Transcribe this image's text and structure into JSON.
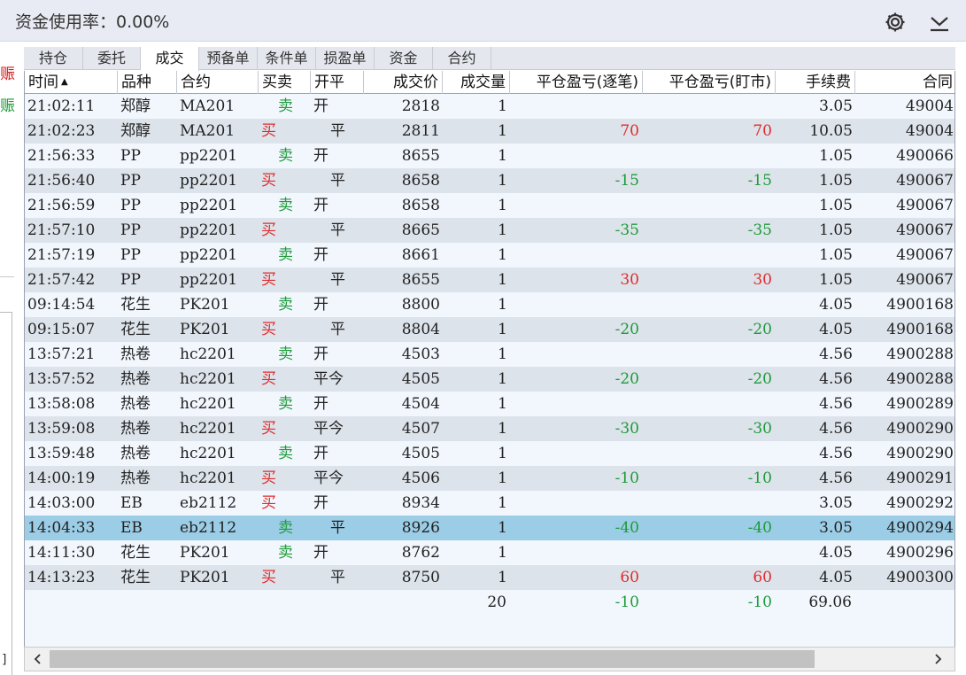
{
  "header": {
    "title": "资金使用率：0.00%",
    "settings_icon": "gear-icon",
    "collapse_icon": "chevron-down-icon"
  },
  "left_strip": {
    "char1": "赈",
    "char2": "赈",
    "char3": "]"
  },
  "colors": {
    "red": "#e02c2c",
    "green": "#1d9b3a",
    "selected_row": "#9ccde6",
    "alt_row": "#dde3eb",
    "row": "#f2f7fd"
  },
  "tabs": [
    {
      "label": "持仓",
      "active": false
    },
    {
      "label": "委托",
      "active": false
    },
    {
      "label": "成交",
      "active": true
    },
    {
      "label": "预备单",
      "active": false
    },
    {
      "label": "条件单",
      "active": false
    },
    {
      "label": "损盈单",
      "active": false
    },
    {
      "label": "资金",
      "active": false
    },
    {
      "label": "合约",
      "active": false
    }
  ],
  "columns": [
    {
      "label": "时间",
      "sort": "asc"
    },
    {
      "label": "品种"
    },
    {
      "label": "合约"
    },
    {
      "label": "买卖"
    },
    {
      "label": "开平"
    },
    {
      "label": "成交价"
    },
    {
      "label": "成交量"
    },
    {
      "label": "平仓盈亏(逐笔)"
    },
    {
      "label": "平仓盈亏(盯市)"
    },
    {
      "label": "手续费"
    },
    {
      "label": "合同"
    }
  ],
  "sort_indicator": "▲",
  "rows": [
    [
      "21:02:11",
      "郑醇",
      "MA201",
      "卖",
      "开",
      "2818",
      "1",
      "",
      "",
      "3.05",
      "49004"
    ],
    [
      "21:02:23",
      "郑醇",
      "MA201",
      "买",
      "平",
      "2811",
      "1",
      "70",
      "70",
      "10.05",
      "49004"
    ],
    [
      "21:56:33",
      "PP",
      "pp2201",
      "卖",
      "开",
      "8655",
      "1",
      "",
      "",
      "1.05",
      "490066"
    ],
    [
      "21:56:40",
      "PP",
      "pp2201",
      "买",
      "平",
      "8658",
      "1",
      "-15",
      "-15",
      "1.05",
      "490067"
    ],
    [
      "21:56:59",
      "PP",
      "pp2201",
      "卖",
      "开",
      "8658",
      "1",
      "",
      "",
      "1.05",
      "490067"
    ],
    [
      "21:57:10",
      "PP",
      "pp2201",
      "买",
      "平",
      "8665",
      "1",
      "-35",
      "-35",
      "1.05",
      "490067"
    ],
    [
      "21:57:19",
      "PP",
      "pp2201",
      "卖",
      "开",
      "8661",
      "1",
      "",
      "",
      "1.05",
      "490067"
    ],
    [
      "21:57:42",
      "PP",
      "pp2201",
      "买",
      "平",
      "8655",
      "1",
      "30",
      "30",
      "1.05",
      "490067"
    ],
    [
      "09:14:54",
      "花生",
      "PK201",
      "卖",
      "开",
      "8800",
      "1",
      "",
      "",
      "4.05",
      "4900168"
    ],
    [
      "09:15:07",
      "花生",
      "PK201",
      "买",
      "平",
      "8804",
      "1",
      "-20",
      "-20",
      "4.05",
      "4900168"
    ],
    [
      "13:57:21",
      "热卷",
      "hc2201",
      "卖",
      "开",
      "4503",
      "1",
      "",
      "",
      "4.56",
      "4900288"
    ],
    [
      "13:57:52",
      "热卷",
      "hc2201",
      "买",
      "平今",
      "4505",
      "1",
      "-20",
      "-20",
      "4.56",
      "4900288"
    ],
    [
      "13:58:08",
      "热卷",
      "hc2201",
      "卖",
      "开",
      "4504",
      "1",
      "",
      "",
      "4.56",
      "4900289"
    ],
    [
      "13:59:08",
      "热卷",
      "hc2201",
      "买",
      "平今",
      "4507",
      "1",
      "-30",
      "-30",
      "4.56",
      "4900290"
    ],
    [
      "13:59:48",
      "热卷",
      "hc2201",
      "卖",
      "开",
      "4505",
      "1",
      "",
      "",
      "4.56",
      "4900290"
    ],
    [
      "14:00:19",
      "热卷",
      "hc2201",
      "买",
      "平今",
      "4506",
      "1",
      "-10",
      "-10",
      "4.56",
      "4900291"
    ],
    [
      "14:03:00",
      "EB",
      "eb2112",
      "买",
      "开",
      "8934",
      "1",
      "",
      "",
      "3.05",
      "4900292"
    ],
    [
      "14:04:33",
      "EB",
      "eb2112",
      "卖",
      "平",
      "8926",
      "1",
      "-40",
      "-40",
      "3.05",
      "4900294"
    ],
    [
      "14:11:30",
      "花生",
      "PK201",
      "卖",
      "开",
      "8762",
      "1",
      "",
      "",
      "4.05",
      "4900296"
    ],
    [
      "14:13:23",
      "花生",
      "PK201",
      "买",
      "平",
      "8750",
      "1",
      "60",
      "60",
      "4.05",
      "4900300"
    ]
  ],
  "selected_row": 17,
  "totals": {
    "volume": "20",
    "pnl_trade": "-10",
    "pnl_mark": "-10",
    "fee": "69.06"
  },
  "scrollbar": {
    "left_icon": "chevron-left-icon",
    "right_icon": "chevron-right-icon"
  }
}
